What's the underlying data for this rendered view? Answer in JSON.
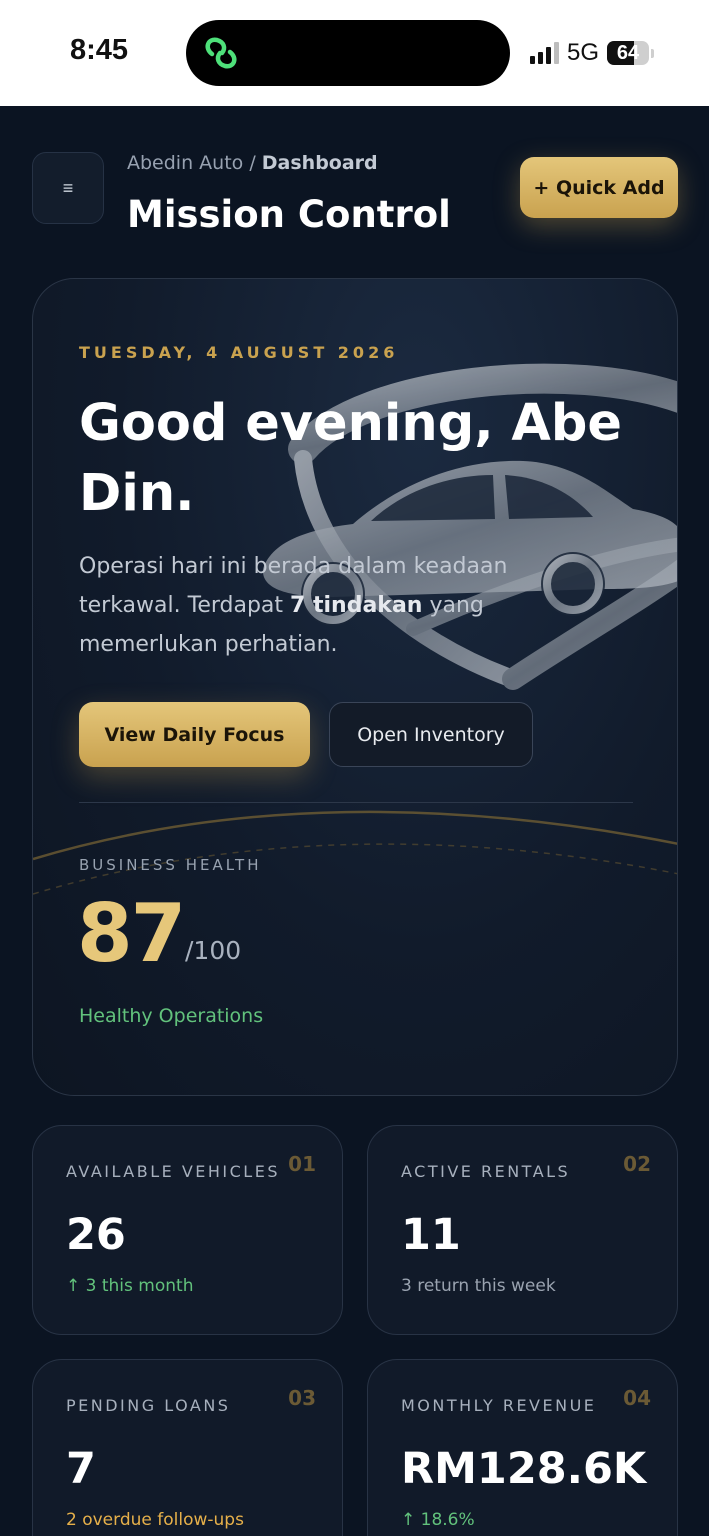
{
  "status_bar": {
    "time": "8:45",
    "network": "5G",
    "battery": "64",
    "battery_level": 0.64
  },
  "header": {
    "breadcrumb_root": "Abedin Auto",
    "breadcrumb_sep": " / ",
    "breadcrumb_current": "Dashboard",
    "title": "Mission Control",
    "quick_add_label": "+ Quick Add",
    "menu_icon": "≡"
  },
  "hero": {
    "date": "TUESDAY, 4 AUGUST 2026",
    "greeting": "Good evening, Abe Din.",
    "subtitle_pre": "Operasi hari ini berada dalam keadaan terkawal. Terdapat ",
    "subtitle_bold": "7 tindakan",
    "subtitle_post": " yang memerlukan perhatian.",
    "primary_button": "View Daily Focus",
    "secondary_button": "Open Inventory",
    "health_label": "BUSINESS HEALTH",
    "health_score": "87",
    "health_max": "/100",
    "health_status": "Healthy Operations"
  },
  "stats": [
    {
      "label": "AVAILABLE VEHICLES",
      "index": "01",
      "value": "26",
      "note": "↑ 3 this month"
    },
    {
      "label": "ACTIVE RENTALS",
      "index": "02",
      "value": "11",
      "note": "3 return this week"
    },
    {
      "label": "PENDING LOANS",
      "index": "03",
      "value": "7",
      "note": "2 overdue follow-ups"
    },
    {
      "label": "MONTHLY REVENUE",
      "index": "04",
      "value": "RM128.6K",
      "note": "↑ 18.6%"
    }
  ],
  "colors": {
    "background": "#0b1422",
    "gold": "#c9a24f",
    "gold_light": "#e6c77a",
    "positive": "#62c27c",
    "warning": "#e6b04a"
  }
}
